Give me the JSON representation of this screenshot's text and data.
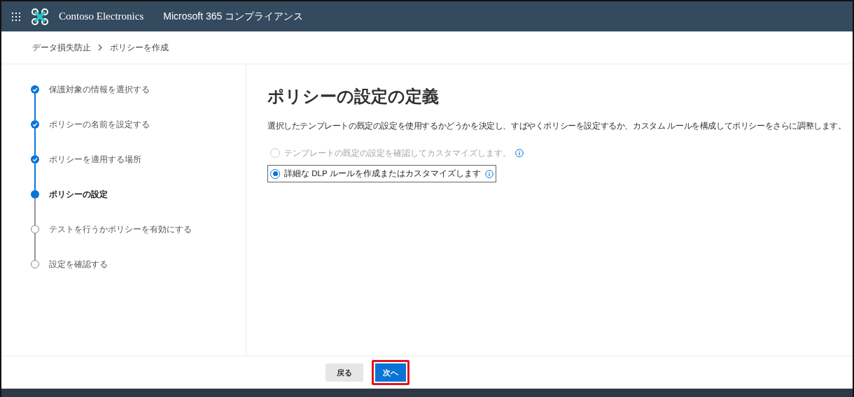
{
  "header": {
    "org_name": "Contoso Electronics",
    "app_title": "Microsoft 365 コンプライアンス"
  },
  "breadcrumb": [
    {
      "label": "データ損失防止"
    },
    {
      "label": "ポリシーを作成"
    }
  ],
  "steps": [
    {
      "label": "保護対象の情報を選択する",
      "kind": "done"
    },
    {
      "label": "ポリシーの名前を設定する",
      "kind": "done"
    },
    {
      "label": "ポリシーを適用する場所",
      "kind": "done"
    },
    {
      "label": "ポリシーの設定",
      "kind": "current"
    },
    {
      "label": "テストを行うかポリシーを有効にする",
      "kind": "pending"
    },
    {
      "label": "設定を確認する",
      "kind": "pending"
    }
  ],
  "main": {
    "heading": "ポリシーの設定の定義",
    "description": "選択したテンプレートの既定の設定を使用するかどうかを決定し、すばやくポリシーを設定するか、カスタム ルールを構成してポリシーをさらに調整します。",
    "options": [
      {
        "label": "テンプレートの既定の設定を確認してカスタマイズします。",
        "selected": false,
        "disabled": true,
        "focused": false
      },
      {
        "label": "詳細な DLP ルールを作成またはカスタマイズします",
        "selected": true,
        "disabled": false,
        "focused": true
      }
    ]
  },
  "footer": {
    "buttons": [
      {
        "label": "戻る",
        "kind": "secondary",
        "highlighted": false
      },
      {
        "label": "次へ",
        "kind": "primary",
        "highlighted": true
      }
    ]
  }
}
